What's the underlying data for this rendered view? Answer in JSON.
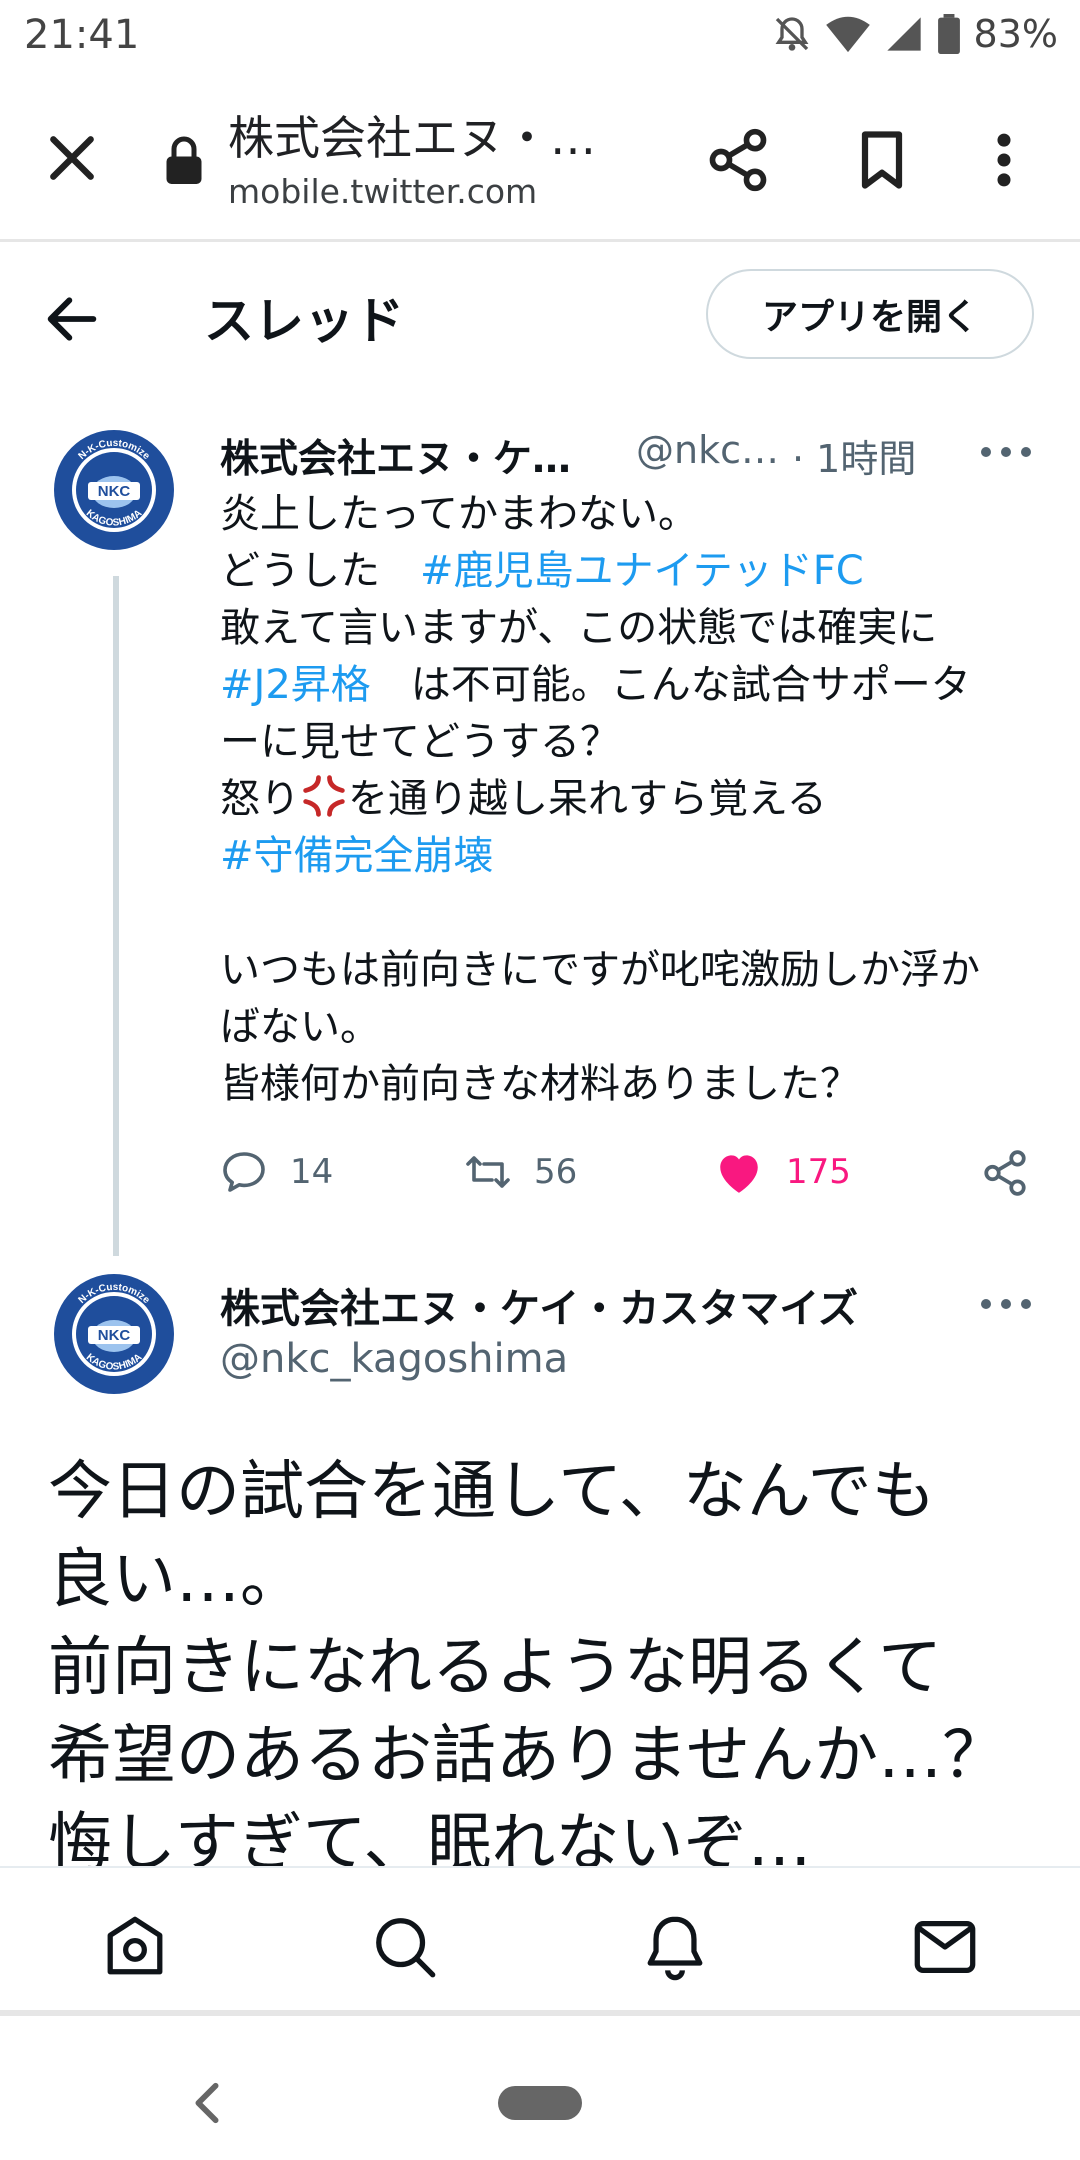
{
  "status_bar": {
    "time": "21:41",
    "battery": "83%"
  },
  "browser": {
    "title": "株式会社エヌ・…",
    "url": "mobile.twitter.com"
  },
  "header": {
    "title": "スレッド",
    "open_app": "アプリを開く"
  },
  "tweet1": {
    "name": "株式会社エヌ・ケ…",
    "handle": "@nkc…",
    "time": "· 1時間",
    "line1": "炎上したってかまわない。",
    "line2_prefix": "どうした　",
    "line2_tag": "#鹿児島ユナイテッドFC",
    "line3": "敢えて言いますが、この状態では確実に",
    "line4_tag": "#J2昇格",
    "line4_rest": "　は不可能。こんな試合サポータ",
    "line5": "ーに見せてどうする？",
    "line6_pre": "怒り",
    "line6_post": "を通り越し呆れすら覚える",
    "line7_tag": "#守備完全崩壊",
    "line8": "いつもは前向きにですが叱咤激励しか浮か",
    "line9": "ばない。",
    "line10": "皆様何か前向きな材料ありました？",
    "replies": "14",
    "retweets": "56",
    "likes": "175"
  },
  "tweet2": {
    "name": "株式会社エヌ・ケイ・カスタマイズ",
    "handle": "@nkc_kagoshima",
    "line1": "今日の試合を通して、なんでも",
    "line2": "良い…。",
    "line3": "前向きになれるような明るくて",
    "line4": "希望のあるお話ありませんか…？",
    "line5": "悔しすぎて、眠れないぞ…"
  },
  "avatar": {
    "ring_text": "N-K-Customize",
    "center_text": "NKC",
    "bottom_text": "KAGOSHIMA"
  },
  "colors": {
    "link": "#1d9bf0",
    "like": "#f91880",
    "avatar_blue": "#1f4e9c"
  }
}
